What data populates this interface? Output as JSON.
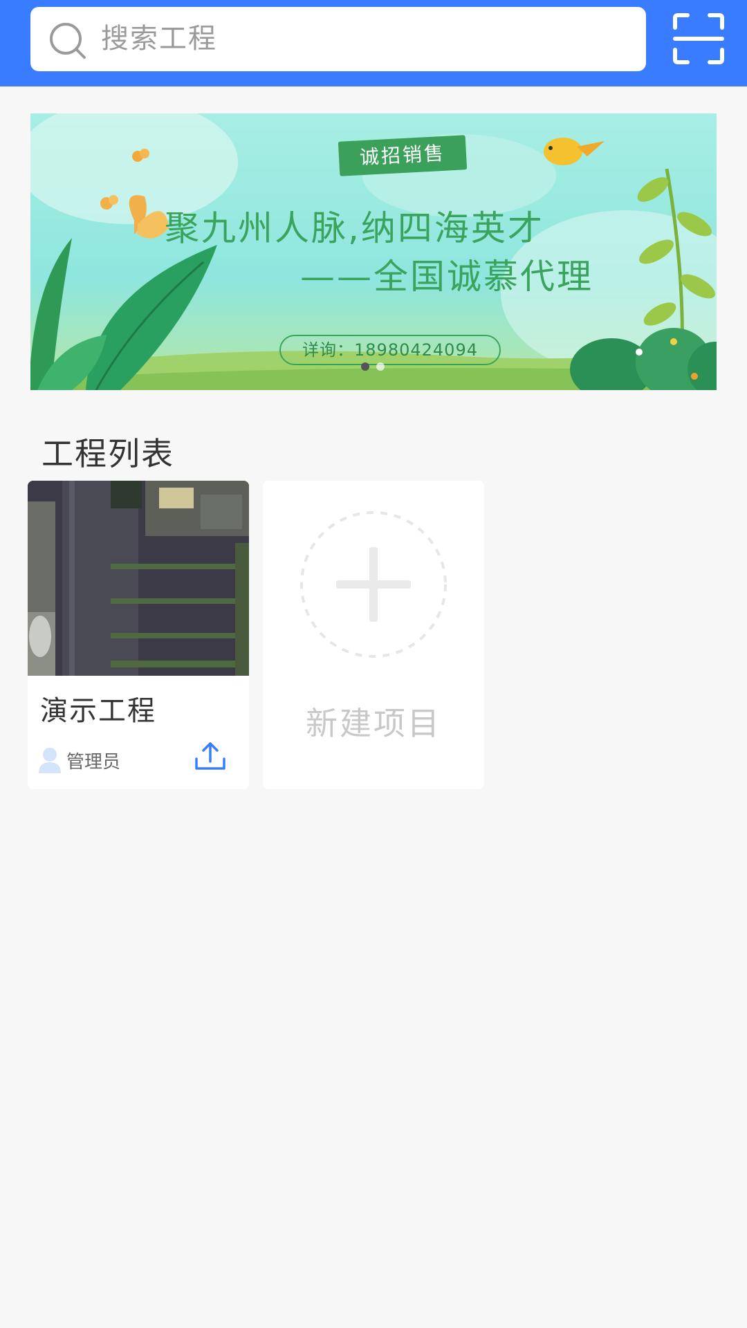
{
  "header": {
    "search_placeholder": "搜索工程",
    "scan_icon": "scan-icon",
    "background_color": "#3a7cff"
  },
  "banner": {
    "tag": "诚招销售",
    "line1": "聚九州人脉,纳四海英才",
    "line2": "——全国诚慕代理",
    "contact": "详询：18980424094",
    "active_slide": 1,
    "slide_count": 2
  },
  "section": {
    "title": "工程列表"
  },
  "projects": [
    {
      "name": "演示工程",
      "owner": "管理员",
      "owner_icon": "user-icon",
      "action_icon": "upload-icon"
    }
  ],
  "new_project": {
    "label": "新建项目",
    "icon": "plus-icon"
  }
}
